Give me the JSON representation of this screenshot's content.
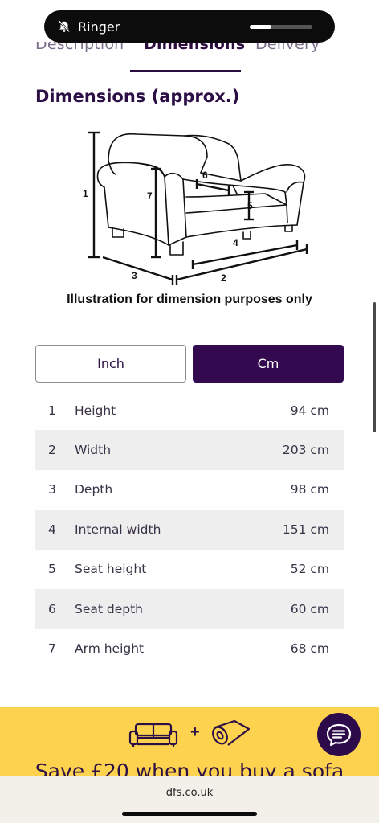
{
  "status_overlay": {
    "label": "Ringer",
    "volume_fraction": 0.34
  },
  "tabs": [
    {
      "label": "Description"
    },
    {
      "label": "Dimensions"
    },
    {
      "label": "Delivery"
    }
  ],
  "section": {
    "title": "Dimensions (approx.)"
  },
  "illustration": {
    "caption": "Illustration for dimension purposes only",
    "markers": [
      "1",
      "2",
      "3",
      "4",
      "5",
      "6",
      "7"
    ]
  },
  "units": {
    "inch_label": "Inch",
    "cm_label": "Cm",
    "selected": "Cm"
  },
  "dimensions": [
    {
      "num": "1",
      "name": "Height",
      "value": "94 cm"
    },
    {
      "num": "2",
      "name": "Width",
      "value": "203 cm"
    },
    {
      "num": "3",
      "name": "Depth",
      "value": "98 cm"
    },
    {
      "num": "4",
      "name": "Internal width",
      "value": "151 cm"
    },
    {
      "num": "5",
      "name": "Seat height",
      "value": "52 cm"
    },
    {
      "num": "6",
      "name": "Seat depth",
      "value": "60 cm"
    },
    {
      "num": "7",
      "name": "Arm height",
      "value": "68 cm"
    }
  ],
  "promo": {
    "text": "Save £20 when you buy a sofa"
  },
  "browser": {
    "url": "dfs.co.uk"
  },
  "colors": {
    "brand_purple": "#330a4f",
    "promo_yellow": "#fdd24f",
    "row_shade": "#eeeeee"
  }
}
